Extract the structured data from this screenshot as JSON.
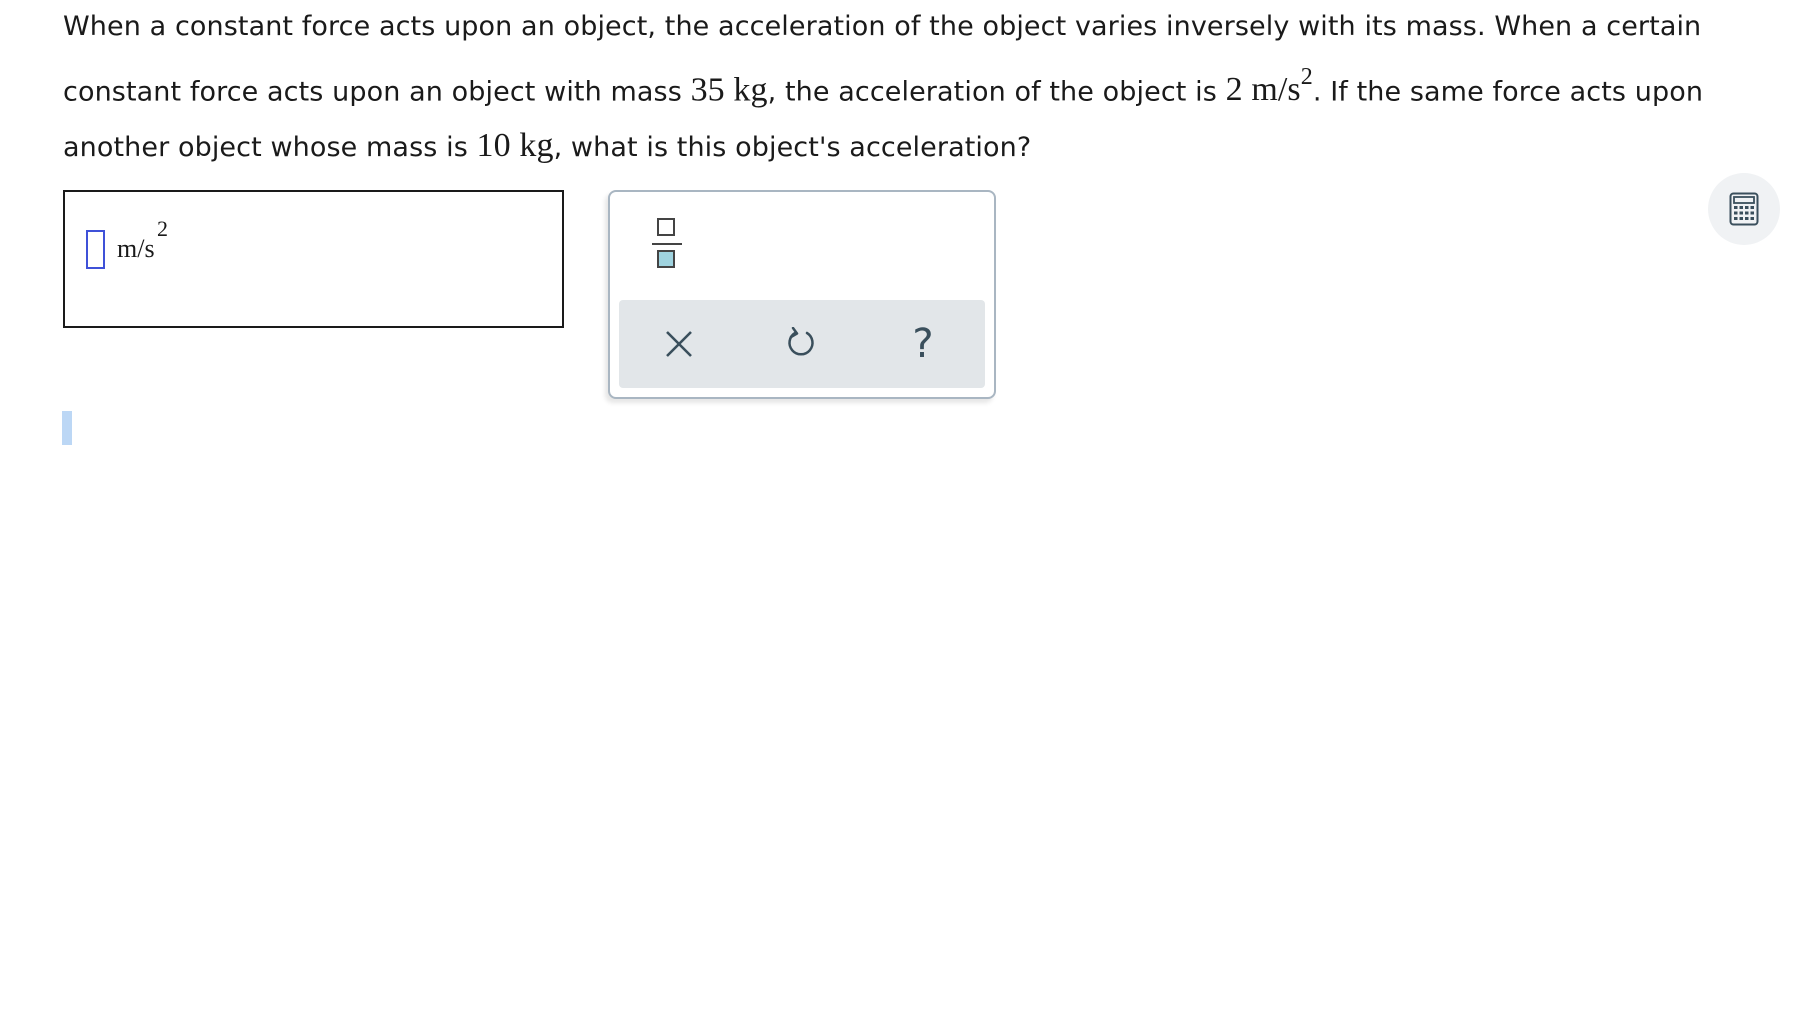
{
  "question": {
    "line1": "When a constant force acts upon an object, the acceleration of the object varies inversely with its mass. When a certain",
    "part_a": "constant force acts upon an object with mass ",
    "mass1": "35",
    "unit_kg": "kg",
    "part_b": ", the acceleration of the object is ",
    "accel1": "2",
    "unit_accel": "m/s",
    "accel_exp": "2",
    "part_c": ". If the same force acts upon",
    "part_d": "another object whose mass is ",
    "mass2": "10",
    "part_e": ", what is this object's acceleration?"
  },
  "answer": {
    "value": "",
    "unit": "m/s",
    "unit_exponent": "2"
  },
  "palette": {
    "buttons": [
      "fraction-icon",
      "clear-icon",
      "undo-icon",
      "help-icon"
    ],
    "help_glyph": "?"
  },
  "colors": {
    "slot_border": "#3f51d8",
    "palette_border": "#a9b6c2",
    "action_bar": "#e2e6e9",
    "fraction_fill": "#9fd3df"
  }
}
